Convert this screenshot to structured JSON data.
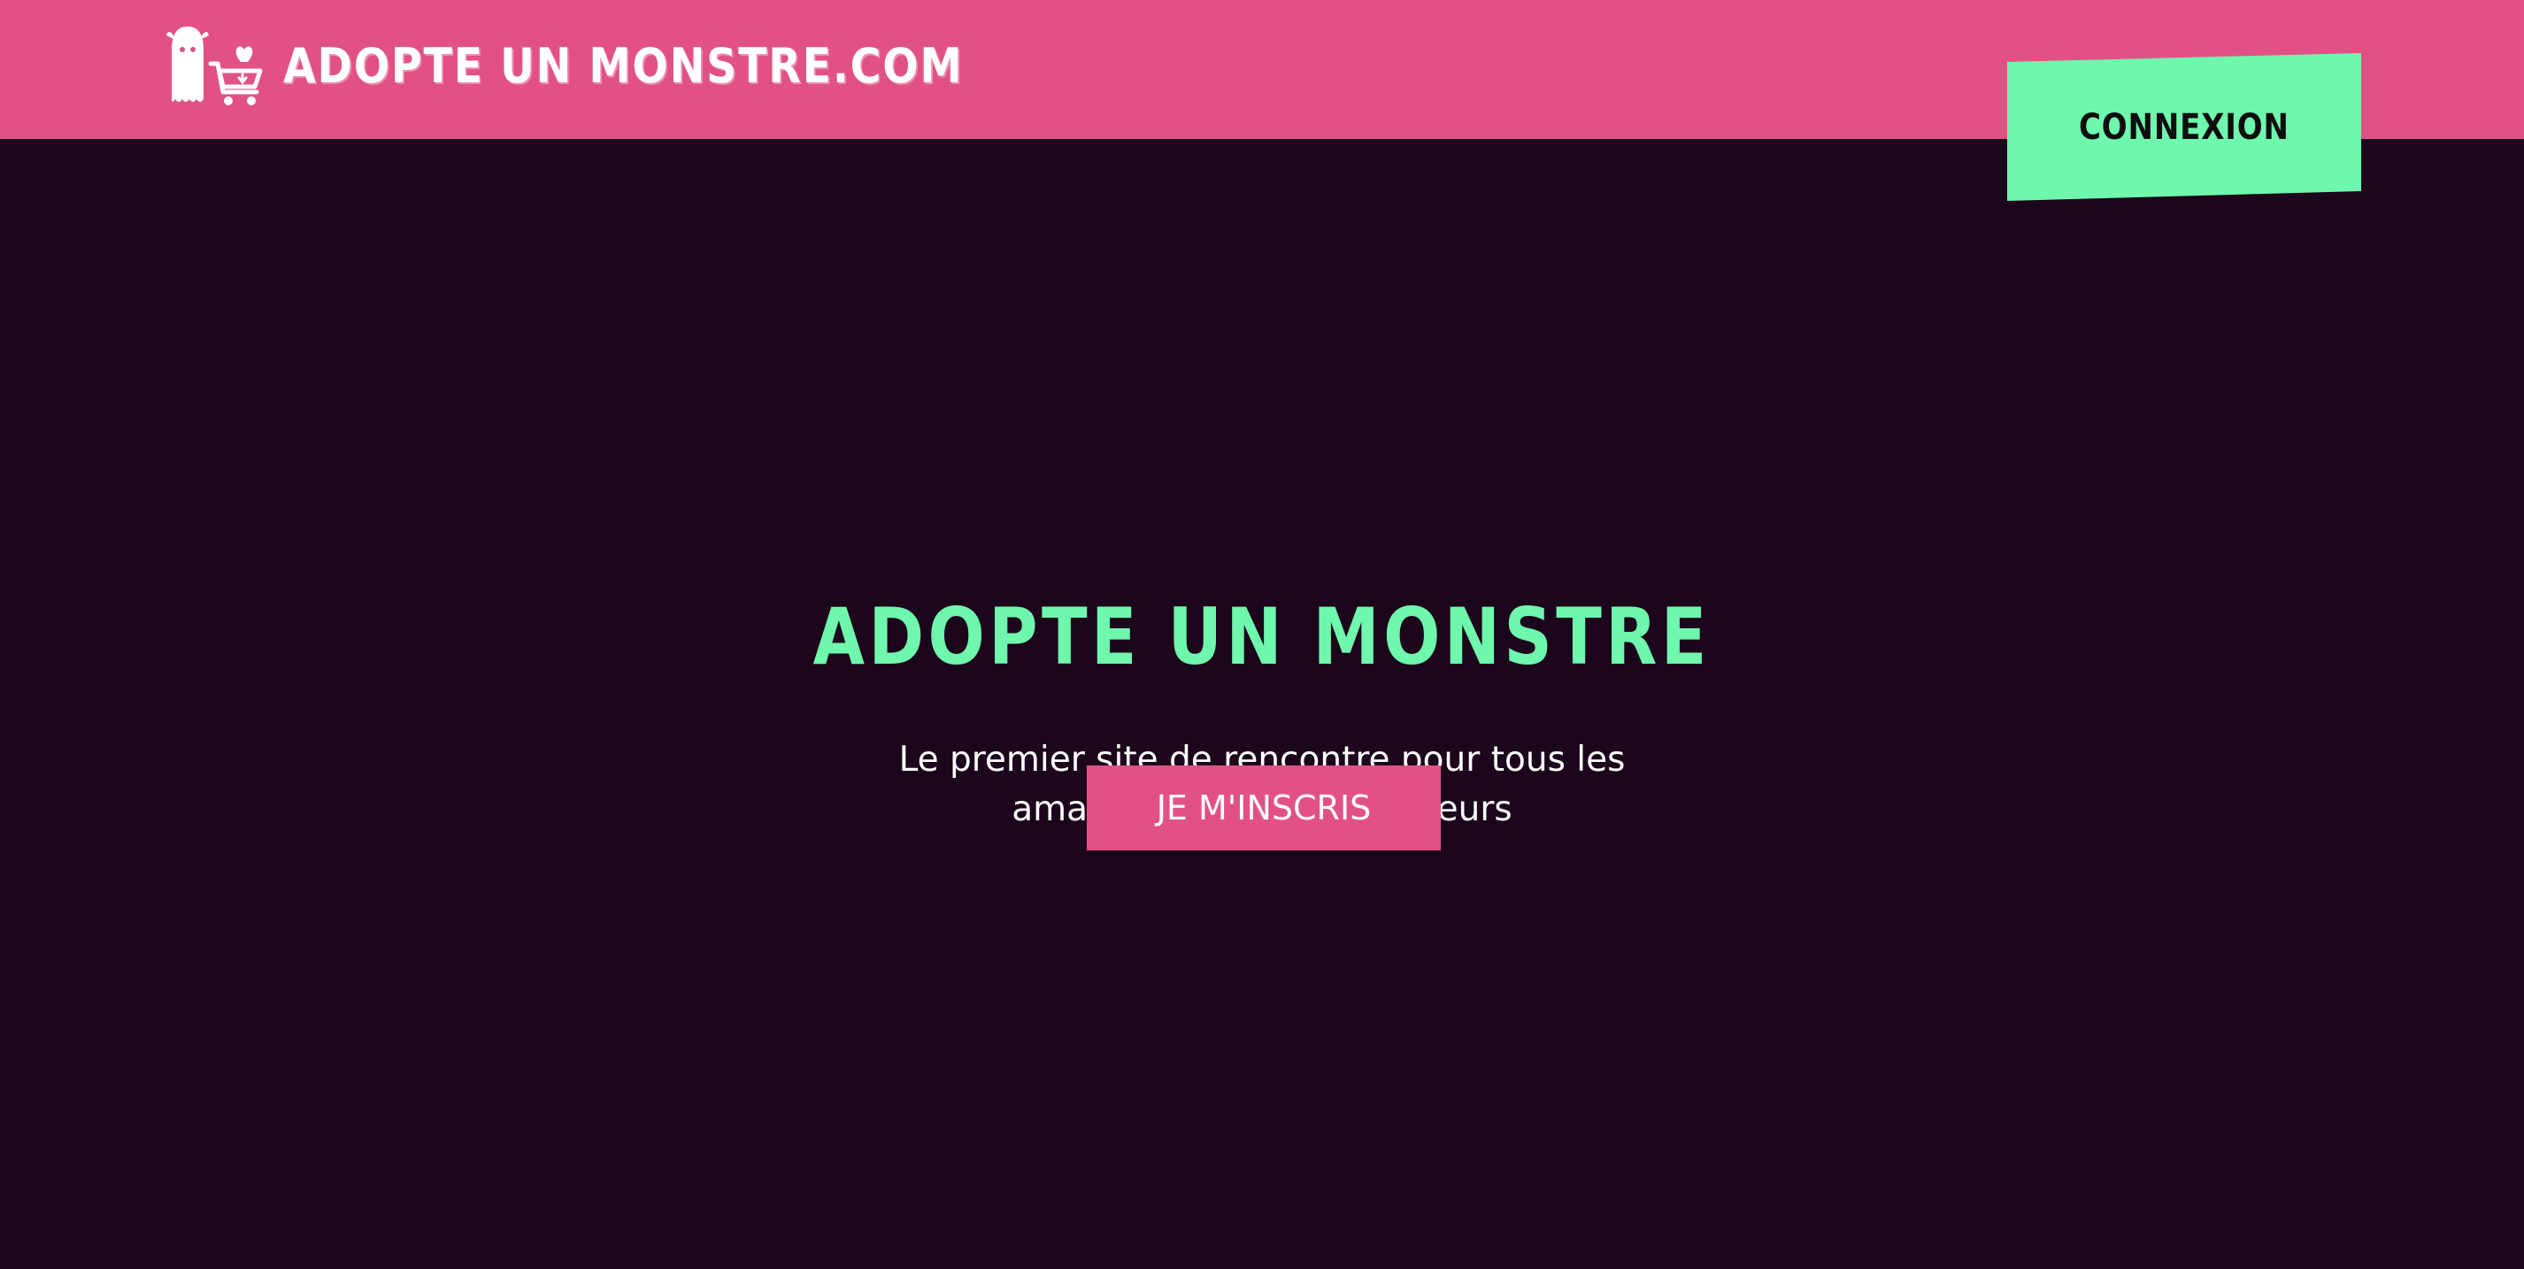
{
  "header": {
    "brand_name": "adopte un monstre.com",
    "logo_icon": "ghost-with-shopping-cart-icon",
    "login_label": "Connexion"
  },
  "hero": {
    "title": "Adopte un monstre",
    "subtitle": "Le premier site de rencontre pour tous les amateurs de films d'horreurs",
    "cta_label": "Je m'inscris"
  },
  "colors": {
    "header_bg": "#e25186",
    "page_bg": "#1c061c",
    "accent_green": "#6ff7ad",
    "cta_bg": "#e25186",
    "text_white": "#ffffff"
  }
}
